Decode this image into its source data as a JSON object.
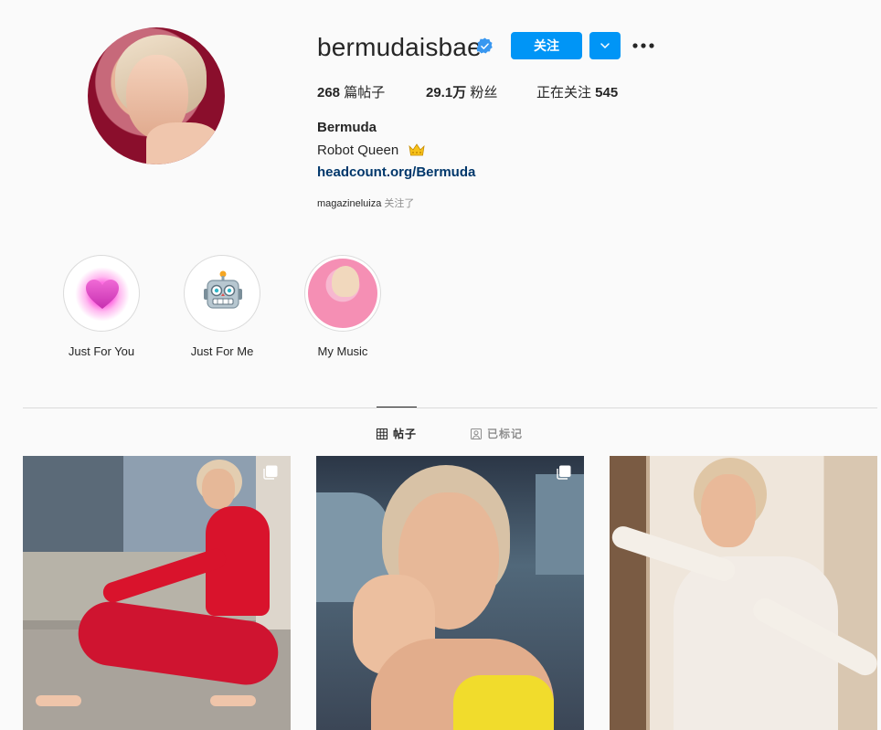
{
  "profile": {
    "username": "bermudaisbae",
    "verified": true,
    "follow_label": "关注",
    "stats": {
      "posts_count": "268",
      "posts_label": " 篇帖子",
      "followers_count": "29.1万",
      "followers_label": " 粉丝",
      "following_label": "正在关注 ",
      "following_count": "545"
    },
    "full_name": "Bermuda",
    "bio": "Robot Queen",
    "bio_emoji": "crown-icon",
    "link": "headcount.org/Bermuda",
    "followed_by_user": "magazineluiza",
    "followed_by_suffix": " 关注了"
  },
  "highlights": [
    {
      "label": "Just For You",
      "icon": "heart-icon"
    },
    {
      "label": "Just For Me",
      "icon": "robot-icon"
    },
    {
      "label": "My Music",
      "icon": "music-cover"
    }
  ],
  "tabs": [
    {
      "label": "帖子",
      "icon": "grid-icon",
      "active": true
    },
    {
      "label": "已标记",
      "icon": "tagged-icon",
      "active": false
    }
  ],
  "posts": [
    {
      "type": "multi-photo"
    },
    {
      "type": "multi-photo"
    },
    {
      "type": "photo"
    }
  ],
  "colors": {
    "accent": "#0095f6",
    "link": "#00376b",
    "background": "#fafafa"
  }
}
